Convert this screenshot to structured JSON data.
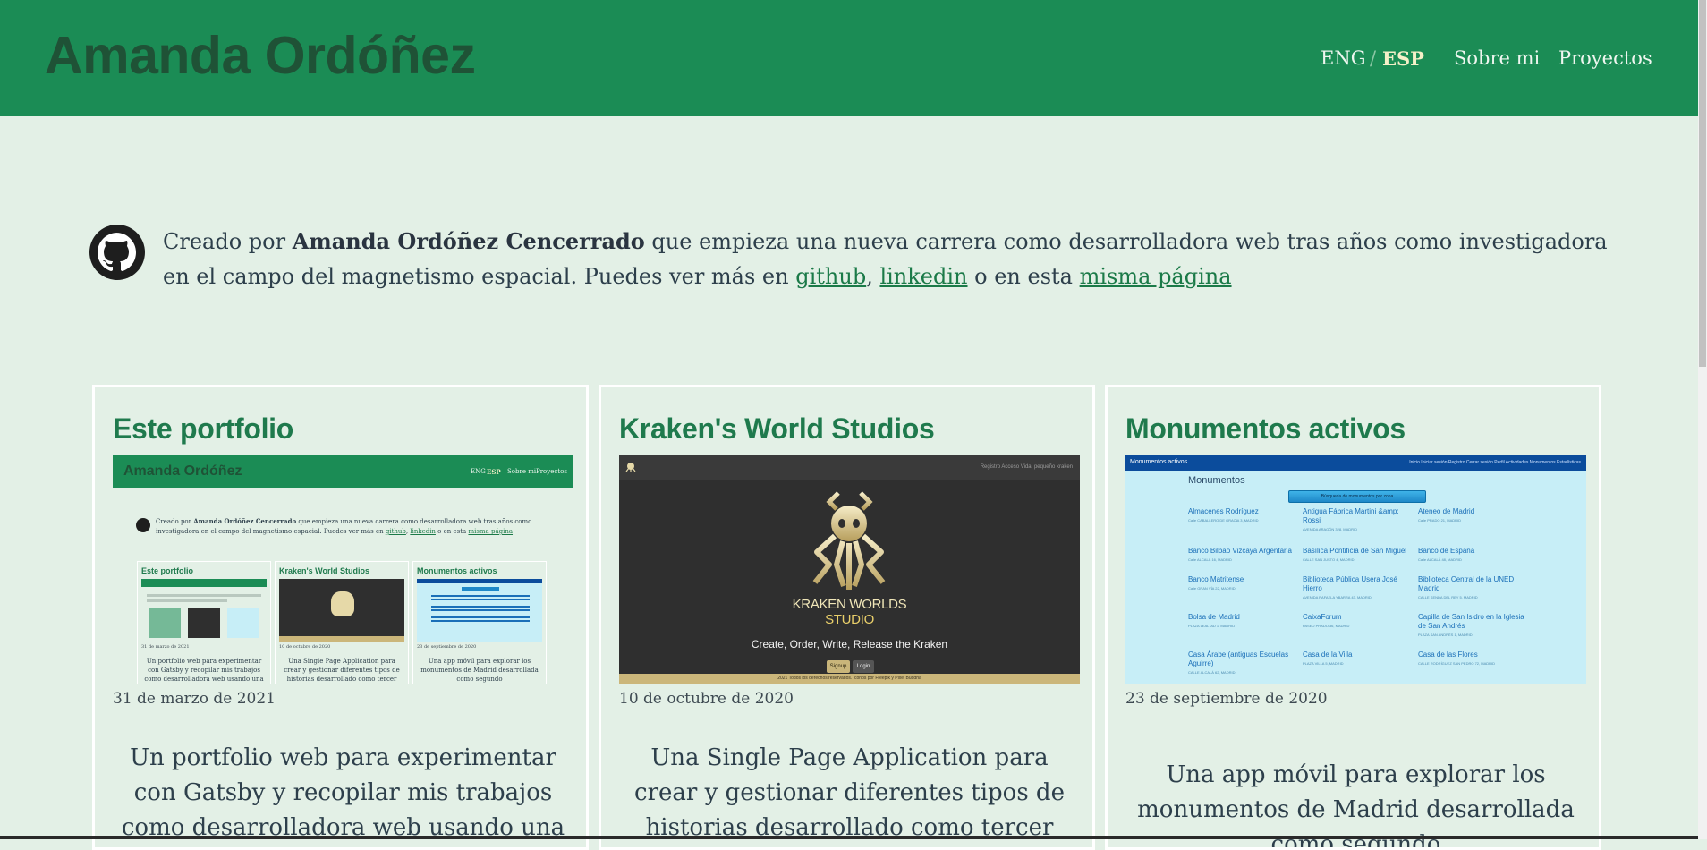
{
  "header": {
    "logo": "Amanda Ordóñez",
    "lang_eng": "ENG",
    "lang_sep": "/",
    "lang_esp": "ESP",
    "nav_about": "Sobre mi",
    "nav_projects": "Proyectos",
    "bg_color": "#1b8c55"
  },
  "intro": {
    "icon": "github-icon",
    "prefix": "Creado por ",
    "name": "Amanda Ordóñez Cencerrado",
    "text1": " que empieza una nueva carrera como desarrolladora web tras años como investigadora en el campo del magnetismo espacial. Puedes ver más en ",
    "link_github": "github",
    "comma": ", ",
    "link_linkedin": "linkedin",
    "text2": " o en esta ",
    "link_page": "misma página"
  },
  "projects": [
    {
      "title": "Este portfolio",
      "date": "31 de marzo de 2021",
      "description": "Un portfolio web para experimentar con Gatsby y recopilar mis trabajos como desarrolladora web usando una plantilla de"
    },
    {
      "title": "Kraken's World Studios",
      "date": "10 de octubre de 2020",
      "description": "Una Single Page Application para crear y gestionar diferentes tipos de historias desarrollado como tercer proyecto del"
    },
    {
      "title": "Monumentos activos",
      "date": "23 de septiembre de 2020",
      "description": "Una app móvil para explorar los monumentos de Madrid desarrollada como segundo"
    }
  ],
  "thumb_portfolio": {
    "logo": "Amanda Ordóñez",
    "nav": [
      "ENG",
      "ESP",
      "Sobre mi",
      "Proyectos"
    ],
    "intro_prefix": "Creado por ",
    "intro_name": "Amanda Ordóñez Cencerrado",
    "intro_text": " que empieza una nueva carrera como desarrolladora web tras años como investigadora en el campo del magnetismo espacial. Puedes ver más en ",
    "link_github": "github",
    "link_linkedin": "linkedin",
    "intro_mid": " o en esta ",
    "link_page": "misma página",
    "cards": [
      {
        "title": "Este portfolio",
        "date": "31 de marzo de 2021",
        "desc": "Un portfolio web para experimentar con Gatsby y recopilar mis trabajos como desarrolladora web usando una plantilla de"
      },
      {
        "title": "Kraken's World Studios",
        "date": "10 de octubre de 2020",
        "desc": "Una Single Page Application para crear y gestionar diferentes tipos de historias desarrollado como tercer proyecto del"
      },
      {
        "title": "Monumentos activos",
        "date": "23 de septiembre de 2020",
        "desc": "Una app móvil para explorar los monumentos de Madrid desarrollada como segundo"
      }
    ]
  },
  "thumb_kraken": {
    "nav": "Registro   Acceso   Vida, pequeño kraken",
    "logo_line1": "KRAKEN WORLDS",
    "logo_line2": "STUDIO",
    "tagline": "Create, Order, Write, Release the Kraken",
    "signup": "Signup",
    "login": "Login",
    "footer": "2021 Todos los derechos reservados. Iconos por Freepik y Pixel Buddha"
  },
  "thumb_monumentos": {
    "brand": "Monumentos activos",
    "nav": "Inicio   Iniciar sesión   Registro   Cerrar sesión   Perfil   Actividades   Monumentos   Estadísticas",
    "heading": "Monumentos",
    "search_button": "Búsqueda de monumentos por zona",
    "items": [
      {
        "name": "Almacenes Rodríguez",
        "address": "Calle CABALLERO DE GRACIA 3, MADRID"
      },
      {
        "name": "Antigua Fábrica Martini &amp; Rossi",
        "address": "AVENIDA ARAGÓN 328, MADRID"
      },
      {
        "name": "Ateneo de Madrid",
        "address": "Calle PRADO 21, MADRID"
      },
      {
        "name": "Banco Bilbao Vizcaya Argentaria",
        "address": "Calle ALCALÁ 16, MADRID"
      },
      {
        "name": "Basílica Pontificia de San Miguel",
        "address": "CALLE SAN JUSTO 4, MADRID"
      },
      {
        "name": "Banco de España",
        "address": "Calle ALCALÁ 48, MADRID"
      },
      {
        "name": "Banco Matritense",
        "address": "Calle GRAN VÍA 22, MADRID"
      },
      {
        "name": "Biblioteca Pública Usera José Hierro",
        "address": "AVENIDA RAFAELA YBARRA 43, MADRID"
      },
      {
        "name": "Biblioteca Central de la UNED Madrid",
        "address": "CALLE SENDA DEL REY 5, MADRID"
      },
      {
        "name": "Bolsa de Madrid",
        "address": "PLAZA LEALTAD 1, MADRID"
      },
      {
        "name": "CaixaForum",
        "address": "PASEO PRADO 36, MADRID"
      },
      {
        "name": "Capilla de San Isidro en la Iglesia de San Andrés",
        "address": "PLAZA SAN ANDRÉS 1, MADRID"
      },
      {
        "name": "Casa Árabe (antiguas Escuelas Aguirre)",
        "address": "CALLE ALCALÁ 62, MADRID"
      },
      {
        "name": "Casa de la Villa",
        "address": "PLAZA VILLA 5, MADRID"
      },
      {
        "name": "Casa de las Flores",
        "address": "CALLE RODRÍGUEZ SAN PEDRO 72, MADRID"
      }
    ]
  }
}
